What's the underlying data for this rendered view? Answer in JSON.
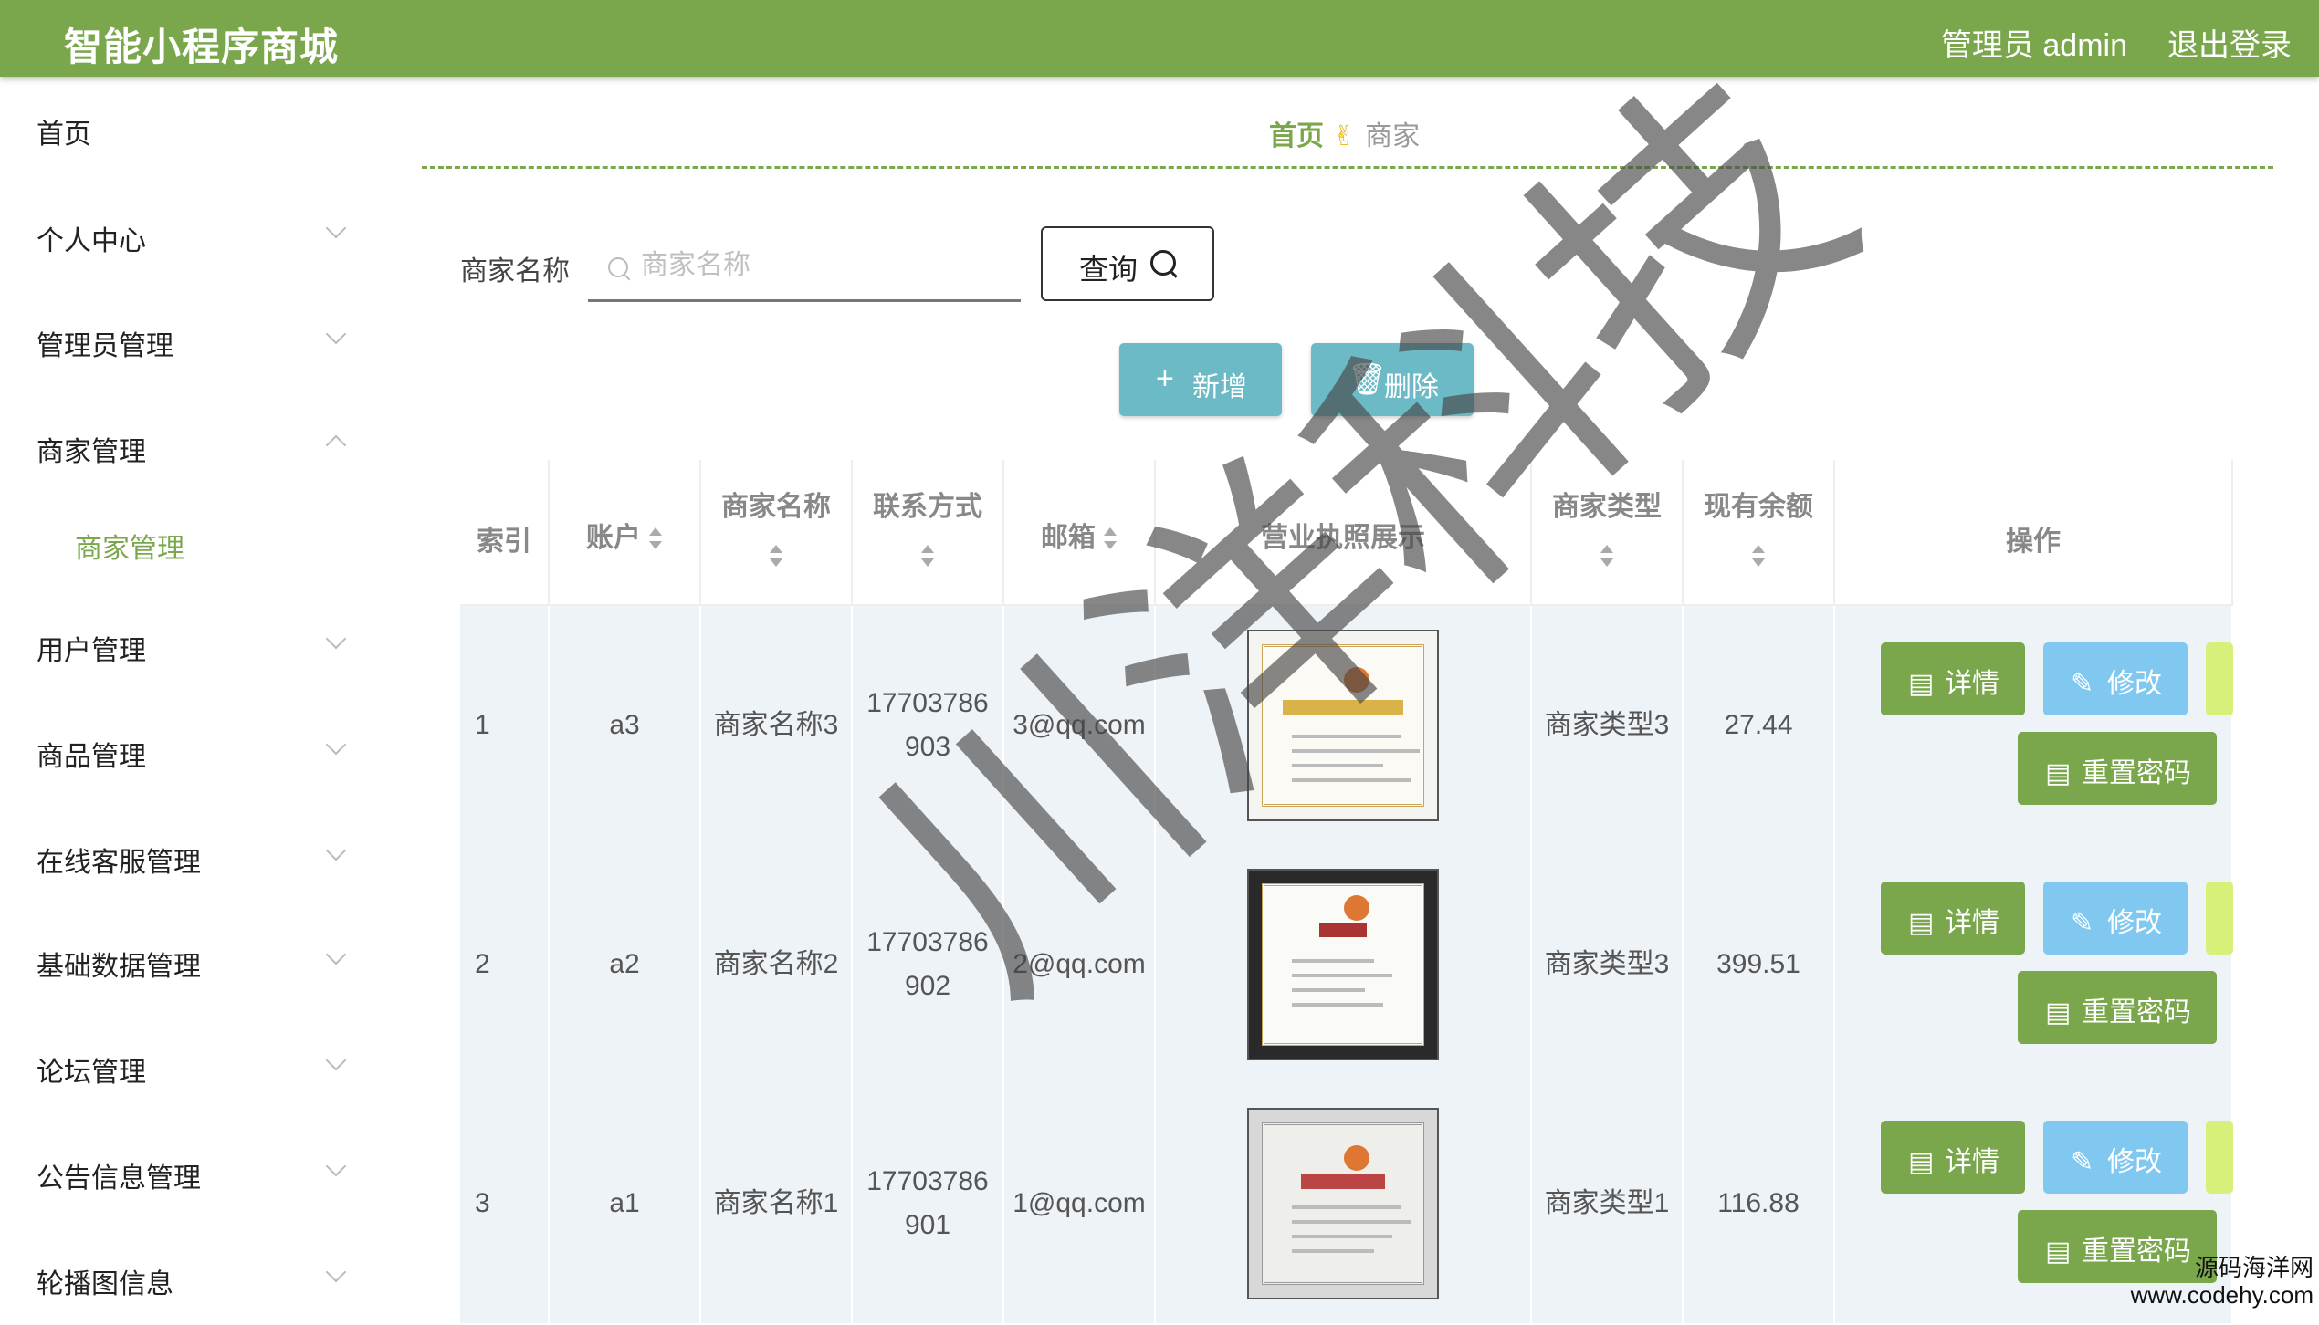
{
  "header": {
    "title": "智能小程序商城",
    "admin_label": "管理员 admin",
    "logout_label": "退出登录"
  },
  "sidebar": {
    "items": [
      {
        "label": "首页"
      },
      {
        "label": "个人中心"
      },
      {
        "label": "管理员管理"
      },
      {
        "label": "商家管理"
      },
      {
        "label": "用户管理"
      },
      {
        "label": "商品管理"
      },
      {
        "label": "在线客服管理"
      },
      {
        "label": "基础数据管理"
      },
      {
        "label": "论坛管理"
      },
      {
        "label": "公告信息管理"
      },
      {
        "label": "轮播图信息"
      }
    ],
    "submenu": {
      "label": "商家管理"
    }
  },
  "breadcrumb": {
    "home": "首页",
    "separator": "✌",
    "current": "商家"
  },
  "search": {
    "label": "商家名称",
    "placeholder": "商家名称",
    "button": "查询"
  },
  "actions": {
    "add": "新增",
    "delete": "删除"
  },
  "table": {
    "headers": [
      "索引",
      "账户",
      "商家名称",
      "联系方式",
      "邮箱",
      "营业执照展示",
      "商家类型",
      "现有余额",
      "操作"
    ],
    "rows": [
      {
        "index": "1",
        "account": "a3",
        "name": "商家名称3",
        "phone": "17703786903",
        "email": "3@qq.com",
        "type": "商家类型3",
        "balance": "27.44"
      },
      {
        "index": "2",
        "account": "a2",
        "name": "商家名称2",
        "phone": "17703786902",
        "email": "2@qq.com",
        "type": "商家类型3",
        "balance": "399.51"
      },
      {
        "index": "3",
        "account": "a1",
        "name": "商家名称1",
        "phone": "17703786901",
        "email": "1@qq.com",
        "type": "商家类型1",
        "balance": "116.88"
      }
    ],
    "row_actions": {
      "detail": "详情",
      "edit": "修改",
      "reset": "重置密码"
    }
  },
  "watermarks": {
    "big": "川洋科技",
    "corner_line1": "源码海洋网",
    "corner_line2": "www.codehy.com"
  },
  "colors": {
    "primary": "#7aa74c",
    "action": "#6cbac6",
    "edit": "#80c8f0",
    "row_bg": "#eef3f8"
  }
}
